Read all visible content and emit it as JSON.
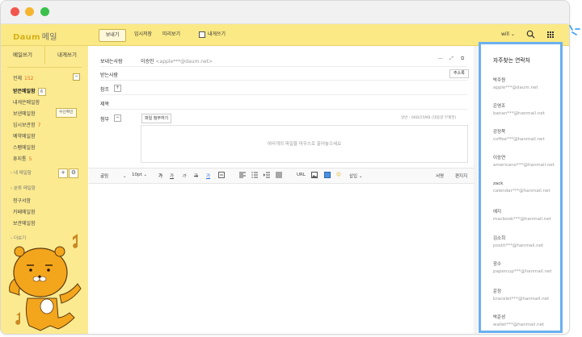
{
  "app": {
    "logo": "Daum",
    "logo_suffix": "메일",
    "toolbar": {
      "send": "보내기",
      "save_draft": "임시저장",
      "preview": "미리보기",
      "to_me": "내게쓰기"
    },
    "user": "will"
  },
  "sidebar": {
    "compose_tab": "메일쓰기",
    "to_me_tab": "내게쓰기",
    "all": "전체",
    "all_count": "152",
    "folders": [
      {
        "label": "받은메일함",
        "count": "6"
      },
      {
        "label": "내게쓴메일함",
        "count": ""
      },
      {
        "label": "보낸메일함",
        "count": ""
      },
      {
        "label": "임시보관함",
        "count": "7"
      },
      {
        "label": "예약메일함",
        "count": ""
      },
      {
        "label": "스팸메일함",
        "count": ""
      },
      {
        "label": "휴지통",
        "count": "5"
      }
    ],
    "read_receipt": "수신확인",
    "my_mailbox": "› 내 메일함",
    "category_mailbox": "› 분류 메일함",
    "categories": [
      "청구서함",
      "카페메일함",
      "보관메일함"
    ],
    "more": "› 더보기"
  },
  "compose": {
    "from_label": "보내는사람",
    "from_name": "이승민",
    "from_email": "<apple***@daum.net>",
    "to_label": "받는사람",
    "address_book": "주소록",
    "cc_label": "참조",
    "subject_label": "제목",
    "attach_label": "첨부",
    "attach_button": "파일 첨부하기",
    "attach_info": "일반 : 0KB/25MB (대용량 무제한)",
    "dropzone_text": "여러개의 파일을 마우스로 끌어놓으세요",
    "editor": {
      "font": "굴림",
      "size": "10pt",
      "bold": "가",
      "underline": "가",
      "italic": "가",
      "strike": "가",
      "font_color": "가",
      "bg_color": "가",
      "url": "URL",
      "insert": "삽입",
      "signature": "서명",
      "edit": "편지지"
    }
  },
  "contacts": {
    "title": "자주찾는 연락처",
    "items": [
      {
        "name": "박주원",
        "email": "apple***@daum.net"
      },
      {
        "name": "은영조",
        "email": "banan***@hanmail.net"
      },
      {
        "name": "강정묵",
        "email": "coffee***@hanmail.net"
      },
      {
        "name": "이승연",
        "email": "americano***@hanmail.net"
      },
      {
        "name": "zack",
        "email": "calendar***@hanmail.net"
      },
      {
        "name": "에지",
        "email": "macbook***@hanmail.net"
      },
      {
        "name": "김소희",
        "email": "postit***@hanmail.net"
      },
      {
        "name": "광수",
        "email": "papercup***@hanmail.net"
      },
      {
        "name": "운정",
        "email": "bracelet***@hanmail.net"
      },
      {
        "name": "박준성",
        "email": "wallet***@hanmail.net"
      }
    ]
  }
}
